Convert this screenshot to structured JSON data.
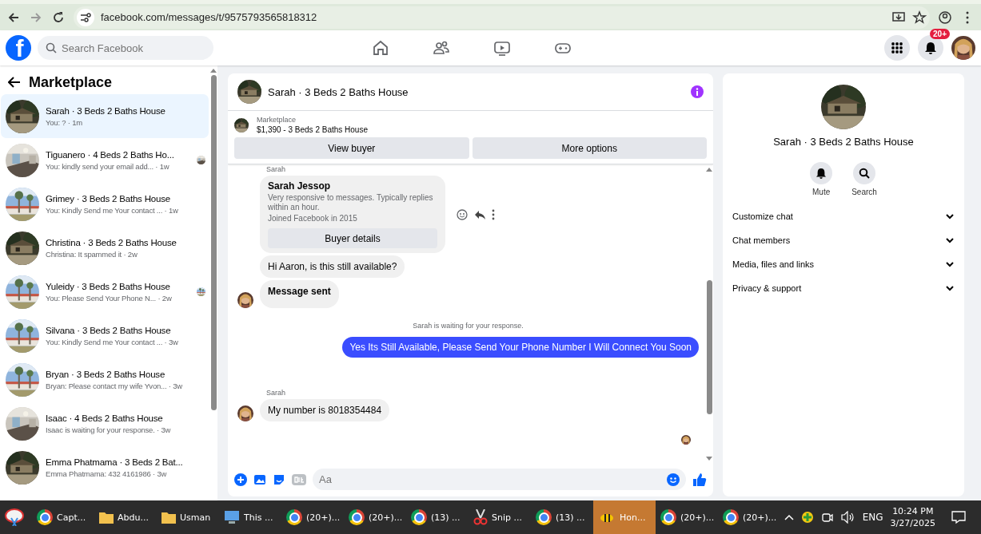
{
  "browser": {
    "url": "facebook.com/messages/t/9575793565818312"
  },
  "header": {
    "logo": "f",
    "search_placeholder": "Search Facebook",
    "notification_badge": "20+"
  },
  "sidebar": {
    "title": "Marketplace",
    "conversations": [
      {
        "title": "Sarah · 3 Beds 2 Baths House",
        "subtitle": "You: ? · 1m",
        "selected": true,
        "seen": false
      },
      {
        "title": "Tiguanero · 4 Beds 2 Baths Ho...",
        "subtitle": "You: kindly send your email add... · 1w",
        "selected": false,
        "seen": true
      },
      {
        "title": "Grimey · 3 Beds 2 Baths House",
        "subtitle": "You: Kindly Send me Your contact ... · 1w",
        "selected": false,
        "seen": false
      },
      {
        "title": "Christina · 3 Beds 2 Baths House",
        "subtitle": "Christina: It spammed it · 2w",
        "selected": false,
        "seen": false
      },
      {
        "title": "Yuleidy · 3 Beds 2 Baths House",
        "subtitle": "You: Please Send Your Phone N... · 2w",
        "selected": false,
        "seen": true
      },
      {
        "title": "Silvana · 3 Beds 2 Baths House",
        "subtitle": "You: Kindly Send me Your contact ... · 3w",
        "selected": false,
        "seen": false
      },
      {
        "title": "Bryan · 3 Beds 2 Baths House",
        "subtitle": "Bryan: Please contact my wife Yvon... · 3w",
        "selected": false,
        "seen": false
      },
      {
        "title": "Isaac · 4 Beds 2 Baths House",
        "subtitle": "Isaac is waiting for your response. · 3w",
        "selected": false,
        "seen": false
      },
      {
        "title": "Emma Phatmama · 3 Beds 2 Bat...",
        "subtitle": "Emma Phatmama: 432 4161986 · 3w",
        "selected": false,
        "seen": false
      }
    ]
  },
  "chat": {
    "title": "Sarah · 3 Beds 2 Baths House",
    "listing": {
      "label": "Marketplace",
      "title": "$1,390 - 3 Beds 2 Baths House"
    },
    "buttons": [
      "View buyer",
      "More options"
    ],
    "messages": [
      {
        "kind": "sender",
        "text": "Sarah"
      },
      {
        "kind": "profile_card",
        "name": "Sarah Jessop",
        "description": "Very responsive to messages. Typically replies within an hour.",
        "joined": "Joined Facebook in 2015",
        "button": "Buyer details"
      },
      {
        "kind": "incoming",
        "text": "Hi Aaron, is this still available?",
        "bold": false,
        "avatar": false
      },
      {
        "kind": "incoming",
        "text": "Message sent",
        "bold": true,
        "avatar": true
      },
      {
        "kind": "notice",
        "text": "Sarah is waiting for your response."
      },
      {
        "kind": "outgoing",
        "text": "Yes Its Still Available, Please Send Your Phone Number I Will Connect You Soon"
      },
      {
        "kind": "sender",
        "text": "Sarah"
      },
      {
        "kind": "incoming",
        "text": "My number is 8018354484",
        "bold": false,
        "avatar": true
      },
      {
        "kind": "seen"
      }
    ],
    "composer": {
      "placeholder": "Aa"
    }
  },
  "info_panel": {
    "title": "Sarah · 3 Beds 2 Baths House",
    "actions": [
      {
        "kind": "mute",
        "label": "Mute"
      },
      {
        "kind": "search",
        "label": "Search"
      }
    ],
    "sections": [
      {
        "label": "Customize chat",
        "expanded": false
      },
      {
        "label": "Chat members",
        "expanded": false
      },
      {
        "label": "Media, files and links",
        "expanded": false
      },
      {
        "label": "Privacy & support",
        "expanded": false
      }
    ]
  },
  "taskbar": {
    "apps": [
      {
        "kind": "snip",
        "active": false
      },
      {
        "kind": "chrome",
        "label": "Capt...",
        "active": false
      },
      {
        "kind": "folder",
        "label": "Abdu...",
        "active": false
      },
      {
        "kind": "folder",
        "label": "Usman",
        "active": false
      },
      {
        "kind": "pc",
        "label": "This ...",
        "active": false
      },
      {
        "kind": "chrome",
        "label": "(20+)...",
        "active": false
      },
      {
        "kind": "chrome",
        "label": "(20+)...",
        "active": false
      },
      {
        "kind": "chrome",
        "label": "(13) ...",
        "active": false
      },
      {
        "kind": "scissors",
        "label": "Snip ...",
        "active": false
      },
      {
        "kind": "chrome",
        "label": "(13) ...",
        "active": false
      },
      {
        "kind": "bee",
        "label": "Hon...",
        "active": true
      },
      {
        "kind": "chrome",
        "label": "(20+)...",
        "active": false
      },
      {
        "kind": "chrome",
        "label": "(20+)...",
        "active": false
      }
    ],
    "language": "ENG",
    "time": "10:24 PM",
    "date": "3/27/2025"
  }
}
